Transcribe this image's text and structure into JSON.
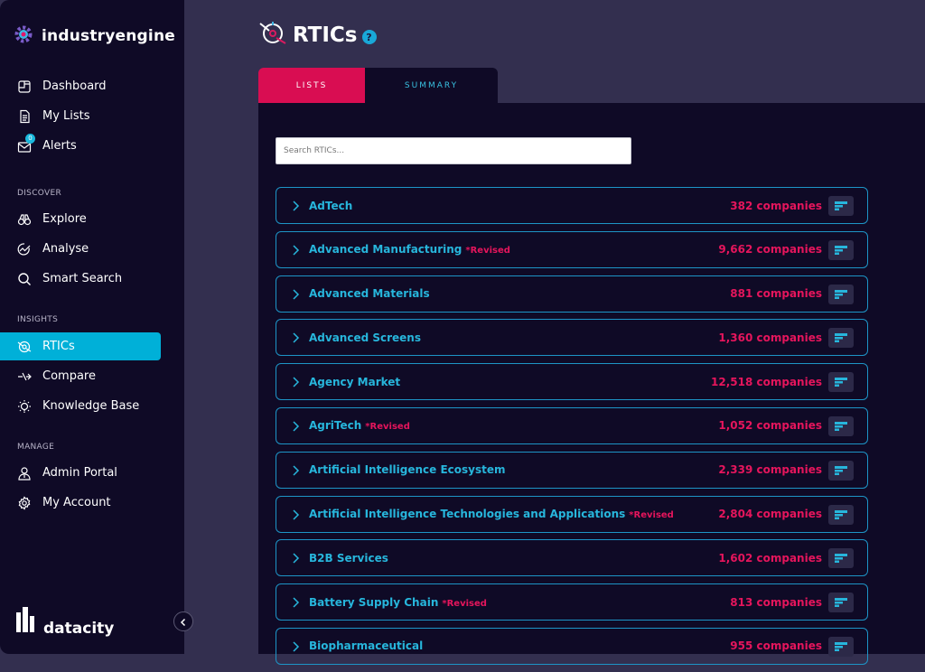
{
  "brand": {
    "name": "industryengine",
    "footer": "datacity"
  },
  "sidebar": {
    "top_items": [
      {
        "label": "Dashboard",
        "icon": "dashboard-icon"
      },
      {
        "label": "My Lists",
        "icon": "list-icon"
      },
      {
        "label": "Alerts",
        "icon": "mail-icon",
        "badge": "0"
      }
    ],
    "sections": [
      {
        "label": "DISCOVER",
        "items": [
          {
            "label": "Explore",
            "icon": "binoculars-icon"
          },
          {
            "label": "Analyse",
            "icon": "analyse-icon"
          },
          {
            "label": "Smart Search",
            "icon": "search-icon"
          }
        ]
      },
      {
        "label": "INSIGHTS",
        "items": [
          {
            "label": "RTICs",
            "icon": "rtic-icon",
            "active": true
          },
          {
            "label": "Compare",
            "icon": "compare-icon"
          },
          {
            "label": "Knowledge Base",
            "icon": "bulb-icon"
          }
        ]
      },
      {
        "label": "MANAGE",
        "items": [
          {
            "label": "Admin Portal",
            "icon": "admin-icon"
          },
          {
            "label": "My Account",
            "icon": "gear-icon"
          }
        ]
      }
    ]
  },
  "page": {
    "title": "RTICs",
    "help": "?"
  },
  "tabs": [
    {
      "label": "LISTS",
      "active": true
    },
    {
      "label": "SUMMARY",
      "active": false
    }
  ],
  "search": {
    "placeholder": "Search RTICs..."
  },
  "rtics": [
    {
      "name": "AdTech",
      "revised": "",
      "count": "382 companies"
    },
    {
      "name": "Advanced Manufacturing",
      "revised": "*Revised",
      "count": "9,662 companies"
    },
    {
      "name": "Advanced Materials",
      "revised": "",
      "count": "881 companies"
    },
    {
      "name": "Advanced Screens",
      "revised": "",
      "count": "1,360 companies"
    },
    {
      "name": "Agency Market",
      "revised": "",
      "count": "12,518 companies"
    },
    {
      "name": "AgriTech",
      "revised": "*Revised",
      "count": "1,052 companies"
    },
    {
      "name": "Artificial Intelligence Ecosystem",
      "revised": "",
      "count": "2,339 companies"
    },
    {
      "name": "Artificial Intelligence Technologies and Applications",
      "revised": "*Revised",
      "count": "2,804 companies"
    },
    {
      "name": "B2B Services",
      "revised": "",
      "count": "1,602 companies"
    },
    {
      "name": "Battery Supply Chain",
      "revised": "*Revised",
      "count": "813 companies"
    },
    {
      "name": "Biopharmaceutical",
      "revised": "",
      "count": "955 companies"
    }
  ],
  "colors": {
    "accent": "#00b0d8",
    "tab_active": "#d90d52",
    "count": "#e5155c",
    "name": "#27b6dc",
    "sidebar": "#0f0a26",
    "content_bg": "#332f4f"
  }
}
